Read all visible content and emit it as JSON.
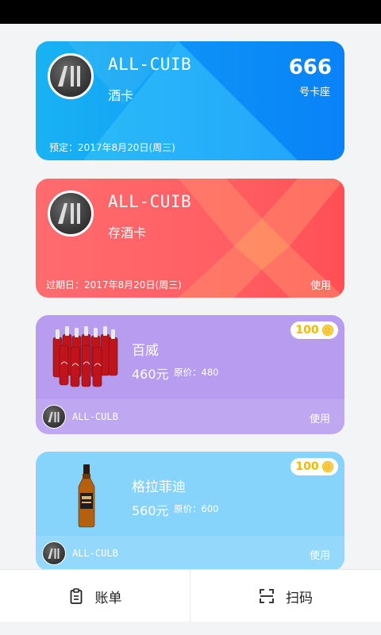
{
  "colors": {
    "card1": "#0f9cf7",
    "card2": "#ff5f63",
    "card3": "#b79cf0",
    "card4": "#86d4fb",
    "points": "#f7b700"
  },
  "cards": [
    {
      "title": "ALL-CUIB",
      "subtitle": "酒卡",
      "seat_number": "666",
      "seat_label": "号卡座",
      "date_text": "预定：2017年8月20日(周三)"
    },
    {
      "title": "ALL-CUIB",
      "subtitle": "存酒卡",
      "date_text": "过期日：2017年8月20日(周三)",
      "action": "使用"
    }
  ],
  "products": [
    {
      "points": "100",
      "name": "百威",
      "price": "460元",
      "original_price": "原价：480",
      "brand": "ALL-CULB",
      "action": "使用",
      "image_icon": "beer-bottles-icon"
    },
    {
      "points": "100",
      "name": "格拉菲迪",
      "price": "560元",
      "original_price": "原价：600",
      "brand": "ALL-CULB",
      "action": "使用",
      "image_icon": "whisky-bottle-icon"
    }
  ],
  "bottom_nav": {
    "bill_label": "账单",
    "bill_icon": "clipboard-icon",
    "scan_label": "扫码",
    "scan_icon": "scan-icon"
  }
}
